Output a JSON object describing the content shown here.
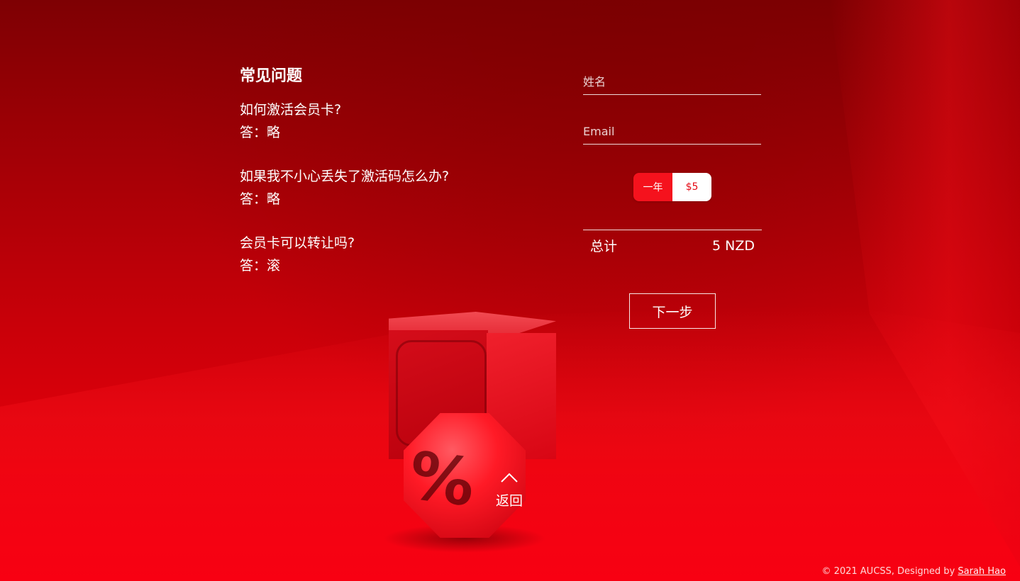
{
  "faq": {
    "title": "常见问题",
    "items": [
      {
        "question": "如何激活会员卡?",
        "answer": "答：略"
      },
      {
        "question": "如果我不小心丢失了激活码怎么办?",
        "answer": "答：略"
      },
      {
        "question": "会员卡可以转让吗?",
        "answer": "答：滚"
      }
    ]
  },
  "form": {
    "name_placeholder": "姓名",
    "email_placeholder": "Email",
    "plan": {
      "period_label": "一年",
      "price_label": "$5"
    },
    "total": {
      "label": "总计",
      "value": "5 NZD"
    },
    "next_label": "下一步"
  },
  "back": {
    "label": "返回",
    "icon": "chevron-up-icon"
  },
  "footer": {
    "text": "© 2021 AUCSS, Designed by ",
    "author_link": "Sarah Hao"
  },
  "colors": {
    "background": "#c8000c",
    "accent": "#f5121d",
    "text": "#ffffff"
  }
}
